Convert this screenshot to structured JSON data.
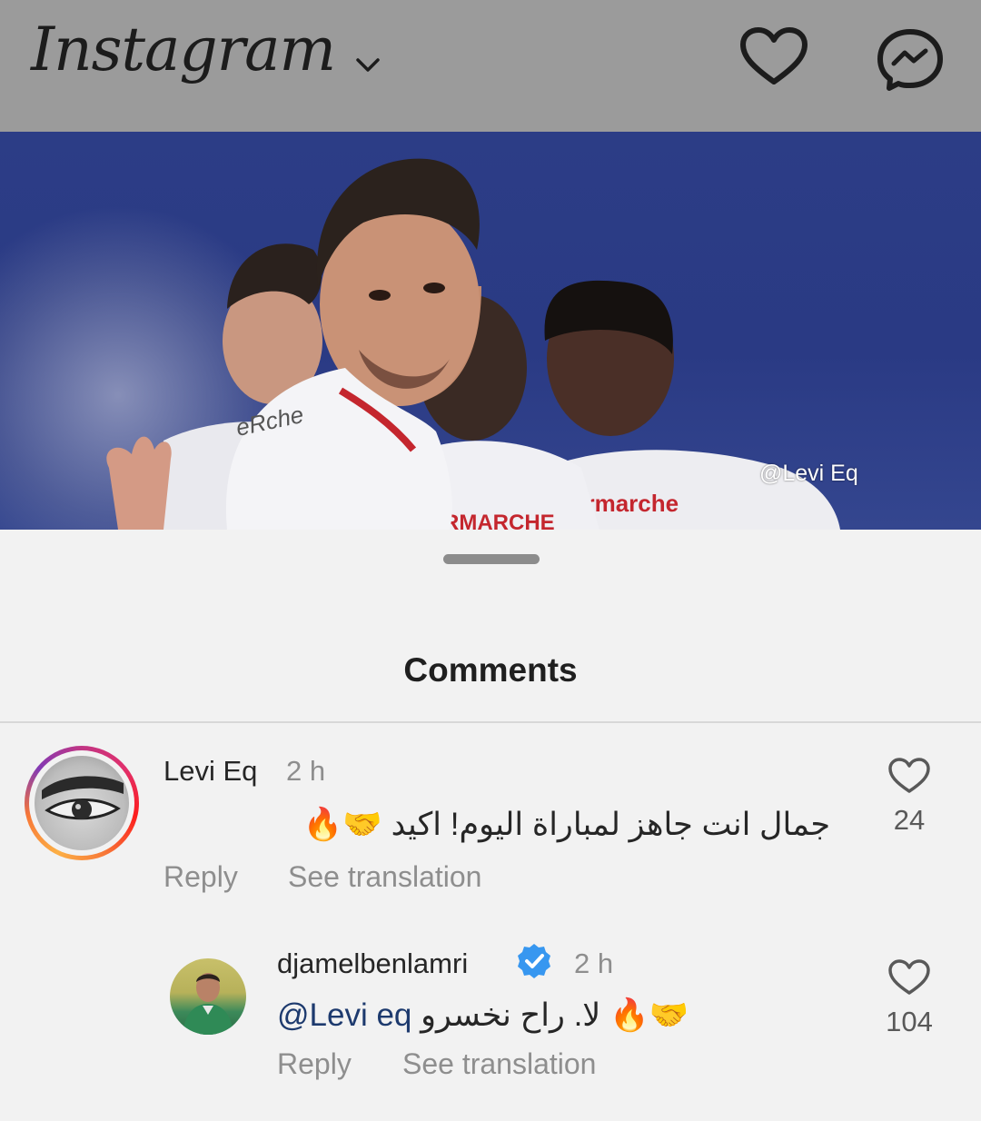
{
  "header": {
    "app_name": "Instagram",
    "icons": {
      "dropdown": "chevron-down-icon",
      "notifications": "heart-icon",
      "messages": "messenger-icon"
    }
  },
  "post": {
    "watermark": "@Levi Eq",
    "shirt_texts": [
      "eRche",
      "ermarche",
      "RMARCHE"
    ]
  },
  "comments_sheet": {
    "title": "Comments",
    "comments": [
      {
        "username": "Levi Eq",
        "time": "2 h",
        "text": "جمال انت جاهز لمباراة اليوم! اكيد 🤝🔥",
        "reply_label": "Reply",
        "translate_label": "See translation",
        "likes": "24"
      },
      {
        "username": "djamelbenlamri",
        "verified": true,
        "time": "2 h",
        "mention": "@Levi eq",
        "text": "🤝🔥 لا. راح نخسرو",
        "reply_label": "Reply",
        "translate_label": "See translation",
        "likes": "104"
      }
    ]
  },
  "colors": {
    "verified_badge": "#3797f0",
    "header_bg": "#9b9b9b",
    "post_bg": "#2c3d86"
  }
}
